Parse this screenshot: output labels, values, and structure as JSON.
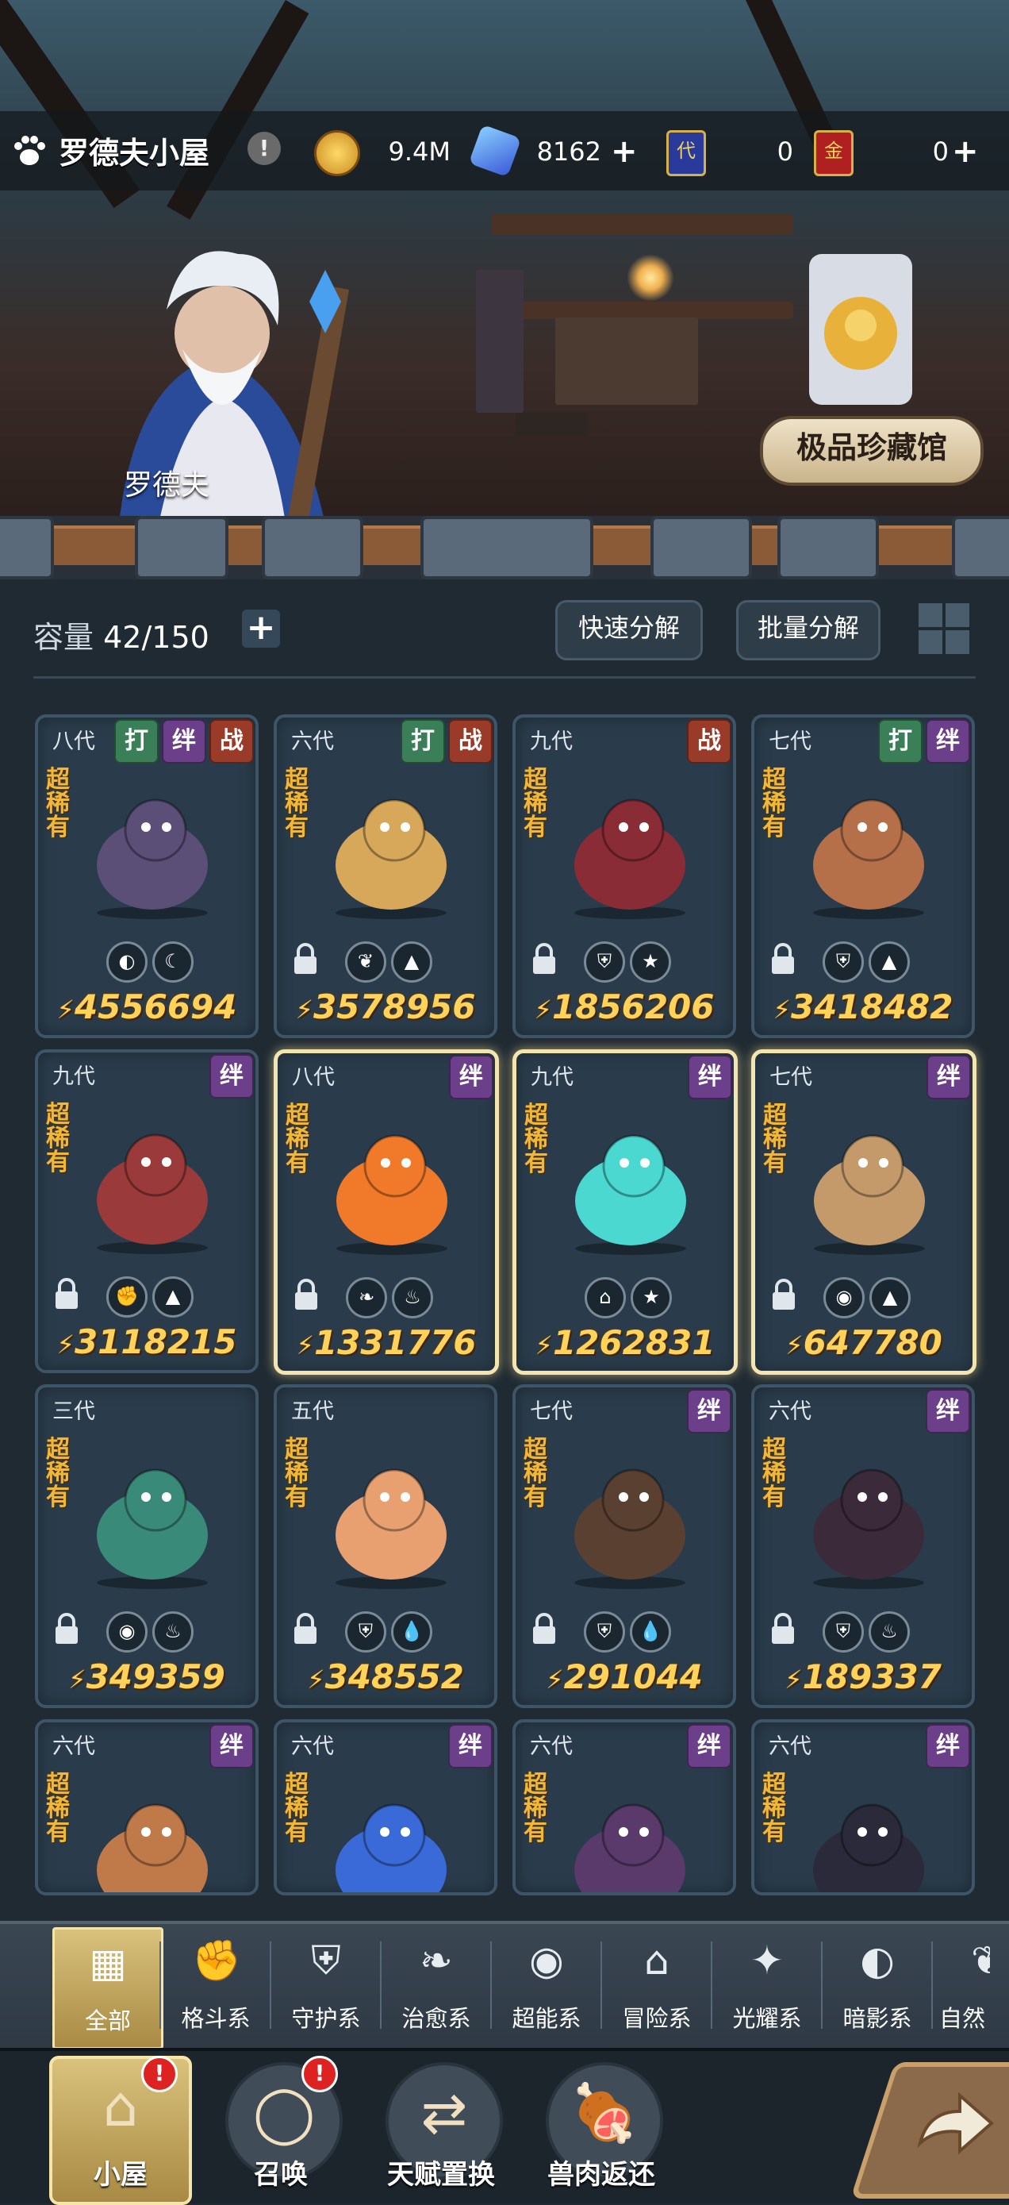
{
  "header": {
    "title": "罗德夫小屋",
    "info_symbol": "!",
    "resources": [
      {
        "name": "gold",
        "value": "9.4M",
        "icon": "gold-coin-icon"
      },
      {
        "name": "crystal",
        "value": "8162",
        "icon": "crystal-icon",
        "plus": "+"
      },
      {
        "name": "card-purple",
        "value": "0",
        "icon": "purple-card-icon"
      },
      {
        "name": "card-red",
        "value": "0",
        "icon": "red-card-icon",
        "plus": "+"
      }
    ],
    "card_letters": [
      "代",
      "金"
    ]
  },
  "scene": {
    "character_name": "罗德夫",
    "museum_button": "极品珍藏馆"
  },
  "toolbar": {
    "capacity_label": "容量",
    "capacity_value": "42/150",
    "plus": "+",
    "quick_decompose": "快速分解",
    "batch_decompose": "批量分解"
  },
  "rarity_label": "超稀有",
  "tag_labels": {
    "fight": "打",
    "bond": "绊",
    "war": "战"
  },
  "cards": [
    {
      "gen": "八代",
      "tags": [
        "fight",
        "bond",
        "war"
      ],
      "power": "4556694",
      "icons": [
        "dark-swirl",
        "moon"
      ],
      "lock": false,
      "creature": "purple-fox",
      "color": "#5b4f78"
    },
    {
      "gen": "六代",
      "tags": [
        "fight",
        "war"
      ],
      "power": "3578956",
      "icons": [
        "leaf",
        "earth"
      ],
      "lock": true,
      "creature": "golden-hedgehog",
      "color": "#d8a85a"
    },
    {
      "gen": "九代",
      "tags": [
        "war"
      ],
      "power": "1856206",
      "icons": [
        "shield",
        "star"
      ],
      "lock": true,
      "creature": "red-spider-dragon",
      "color": "#8a2c36"
    },
    {
      "gen": "七代",
      "tags": [
        "fight",
        "bond"
      ],
      "power": "3418482",
      "icons": [
        "shield",
        "earth"
      ],
      "lock": true,
      "creature": "armored-beast",
      "color": "#b5704a"
    },
    {
      "gen": "九代",
      "tags": [
        "bond"
      ],
      "power": "3118215",
      "icons": [
        "fist",
        "earth"
      ],
      "lock": true,
      "creature": "mushroom-blob",
      "color": "#9a3a3a"
    },
    {
      "gen": "八代",
      "tags": [
        "bond"
      ],
      "power": "1331776",
      "icons": [
        "sprout",
        "fire"
      ],
      "lock": true,
      "creature": "flame-fairy",
      "color": "#f07a2a",
      "selected": true
    },
    {
      "gen": "九代",
      "tags": [
        "bond"
      ],
      "power": "1262831",
      "icons": [
        "adventure",
        "star"
      ],
      "lock": false,
      "creature": "teal-slime",
      "color": "#4ad8d0",
      "selected": true
    },
    {
      "gen": "七代",
      "tags": [
        "bond"
      ],
      "power": "647780",
      "icons": [
        "psy",
        "earth"
      ],
      "lock": true,
      "creature": "bronze-imp",
      "color": "#c49a6a",
      "selected": true
    },
    {
      "gen": "三代",
      "tags": [],
      "power": "349359",
      "icons": [
        "psy",
        "fire"
      ],
      "lock": true,
      "creature": "green-sorceress",
      "color": "#3a8a7a"
    },
    {
      "gen": "五代",
      "tags": [],
      "power": "348552",
      "icons": [
        "shield",
        "water"
      ],
      "lock": true,
      "creature": "fox-girl",
      "color": "#e8a070"
    },
    {
      "gen": "七代",
      "tags": [
        "bond"
      ],
      "power": "291044",
      "icons": [
        "shield",
        "water"
      ],
      "lock": true,
      "creature": "tree-man",
      "color": "#5a4030"
    },
    {
      "gen": "六代",
      "tags": [
        "bond"
      ],
      "power": "189337",
      "icons": [
        "shield",
        "fire"
      ],
      "lock": true,
      "creature": "dark-beast",
      "color": "#3a2a3a"
    },
    {
      "gen": "六代",
      "tags": [
        "bond"
      ],
      "power": "",
      "icons": [],
      "lock": false,
      "creature": "deer",
      "color": "#c07a4a"
    },
    {
      "gen": "六代",
      "tags": [
        "bond"
      ],
      "power": "",
      "icons": [],
      "lock": false,
      "creature": "blue-flame",
      "color": "#3a6ad8"
    },
    {
      "gen": "六代",
      "tags": [
        "bond"
      ],
      "power": "",
      "icons": [],
      "lock": false,
      "creature": "rose-girl",
      "color": "#5a3a6a"
    },
    {
      "gen": "六代",
      "tags": [
        "bond"
      ],
      "power": "",
      "icons": [],
      "lock": false,
      "creature": "dark-wolf",
      "color": "#2a2a3a"
    }
  ],
  "filters": [
    {
      "label": "全部",
      "icon": "all-blocks-icon",
      "active": true
    },
    {
      "label": "格斗系",
      "icon": "fist-icon"
    },
    {
      "label": "守护系",
      "icon": "shield-icon"
    },
    {
      "label": "治愈系",
      "icon": "sprout-icon"
    },
    {
      "label": "超能系",
      "icon": "psychic-icon"
    },
    {
      "label": "冒险系",
      "icon": "adventure-icon"
    },
    {
      "label": "光耀系",
      "icon": "sparkle-icon"
    },
    {
      "label": "暗影系",
      "icon": "shadow-icon"
    },
    {
      "label": "自然",
      "icon": "nature-icon"
    }
  ],
  "nav": [
    {
      "label": "小屋",
      "icon": "house-icon",
      "badge": "!",
      "active": true
    },
    {
      "label": "召唤",
      "icon": "egg-icon",
      "badge": "!"
    },
    {
      "label": "天赋置换",
      "icon": "swap-icon"
    },
    {
      "label": "兽肉返还",
      "icon": "meat-icon"
    }
  ],
  "colors": {
    "gold": "#ffd25a",
    "rare": "#f0b838",
    "bond": "#6b3f8a",
    "fight": "#3b7f58",
    "war": "#9a3b2a"
  }
}
